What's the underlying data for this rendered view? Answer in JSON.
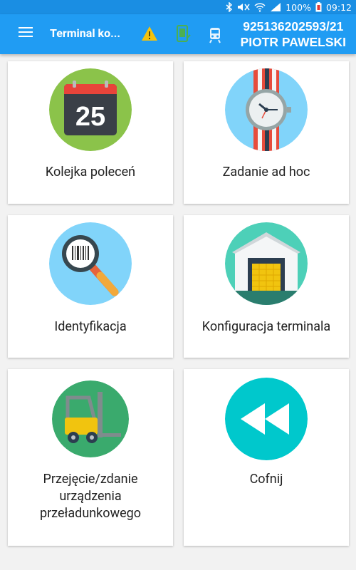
{
  "status_bar": {
    "battery": "100%",
    "time": "09:12"
  },
  "app_bar": {
    "title": "Terminal ko...",
    "terminal_id": "925136202593/21",
    "user_name": "PIOTR PAWELSKI"
  },
  "tiles": [
    {
      "label": "Kolejka poleceń",
      "icon": "calendar-icon",
      "calendar_day": "25",
      "color": "#8bc34a"
    },
    {
      "label": "Zadanie ad hoc",
      "icon": "watch-icon",
      "color": "#81d4fa"
    },
    {
      "label": "Identyfikacja",
      "icon": "barcode-magnifier-icon",
      "color": "#81d4fa"
    },
    {
      "label": "Konfiguracja terminala",
      "icon": "warehouse-icon",
      "color": "#4dd0b8"
    },
    {
      "label": "Przejęcie/zdanie urządzenia przeładunkowego",
      "icon": "forklift-icon",
      "color": "#3aaa6d"
    },
    {
      "label": "Cofnij",
      "icon": "rewind-icon",
      "color": "#00c8cc"
    }
  ]
}
